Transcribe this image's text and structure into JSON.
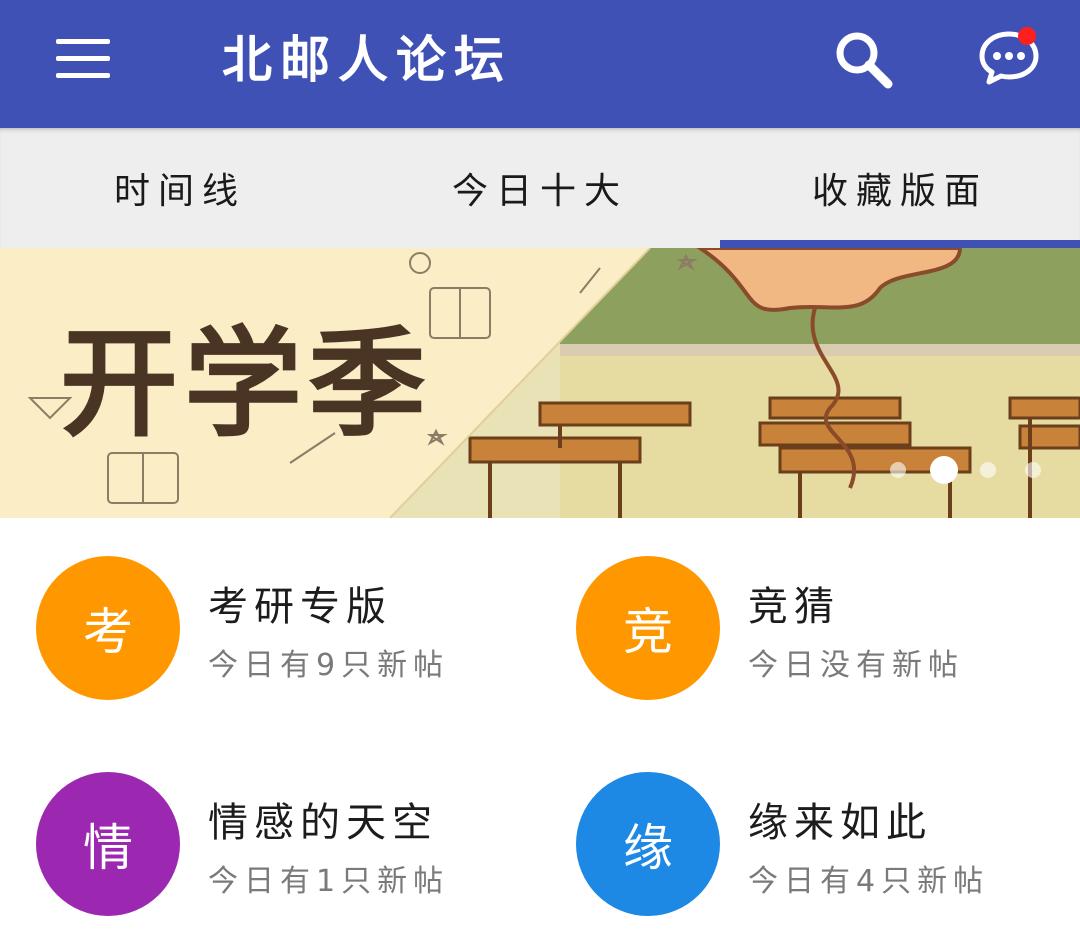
{
  "app_bar": {
    "title": "北邮人论坛",
    "menu_icon": "hamburger-menu-icon",
    "search_icon": "search-icon",
    "message_icon": "chat-bubble-icon",
    "background": "#3f51b5"
  },
  "tabs": [
    {
      "label": "时间线",
      "selected": false
    },
    {
      "label": "今日十大",
      "selected": false
    },
    {
      "label": "收藏版面",
      "selected": true
    }
  ],
  "banner": {
    "headline": "开学季",
    "slide_index": 2,
    "slide_count": 4
  },
  "boards": [
    {
      "icon_char": "考",
      "name": "考研专版",
      "status": "今日有9只新帖",
      "color": "#ff9800"
    },
    {
      "icon_char": "竞",
      "name": "竞猜",
      "status": "今日没有新帖",
      "color": "#ff9800"
    },
    {
      "icon_char": "情",
      "name": "情感的天空",
      "status": "今日有1只新帖",
      "color": "#9c27b0"
    },
    {
      "icon_char": "缘",
      "name": "缘来如此",
      "status": "今日有4只新帖",
      "color": "#1e88e5"
    }
  ]
}
